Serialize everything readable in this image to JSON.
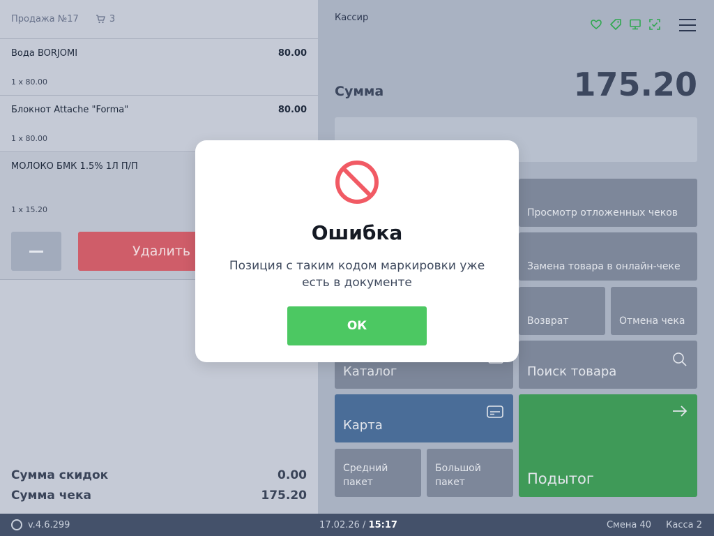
{
  "sale": {
    "title": "Продажа №17",
    "cart_count": "3"
  },
  "items": [
    {
      "name": "Вода BORJOMI",
      "price": "80.00",
      "qty": "1 x 80.00"
    },
    {
      "name": "Блокнот Attache \"Forma\"",
      "price": "80.00",
      "qty": "1 x 80.00"
    },
    {
      "name": "МОЛОКО БМК 1.5% 1Л П/П",
      "price": "",
      "qty": "1 x 15.20"
    }
  ],
  "item_actions": {
    "delete_label": "Удалить"
  },
  "totals": {
    "discount_label": "Сумма скидок",
    "discount_value": "0.00",
    "check_label": "Сумма чека",
    "check_value": "175.20"
  },
  "header": {
    "cashier": "Кассир",
    "icons": [
      "heart-icon",
      "tag-icon",
      "monitor-icon",
      "scan-check-icon",
      "menu-icon"
    ]
  },
  "summary": {
    "label": "Сумма",
    "value": "175.20"
  },
  "tiles": {
    "postponed": "Просмотр отложенных чеков",
    "replace": "Замена товара в онлайн-чеке",
    "return": "Возврат",
    "cancel": "Отмена чека",
    "catalog": "Каталог",
    "search": "Поиск товара",
    "card": "Карта",
    "medium_bag": "Средний пакет",
    "large_bag": "Большой пакет",
    "subtotal": "Подытог"
  },
  "footer": {
    "version": "v.4.6.299",
    "date": "17.02.26",
    "separator": " / ",
    "time": "15:17",
    "shift": "Смена 40",
    "register": "Касса 2"
  },
  "dialog": {
    "title": "Ошибка",
    "message": "Позиция с таким кодом маркировки уже есть в документе",
    "ok_label": "ОК"
  },
  "colors": {
    "ok_button": "#4cc862",
    "delete_button": "#cf5d69",
    "subtotal_tile": "#3f9a58",
    "card_tile": "#4a6d98",
    "error_icon": "#f15a64",
    "header_icons": "#2fa84f"
  }
}
